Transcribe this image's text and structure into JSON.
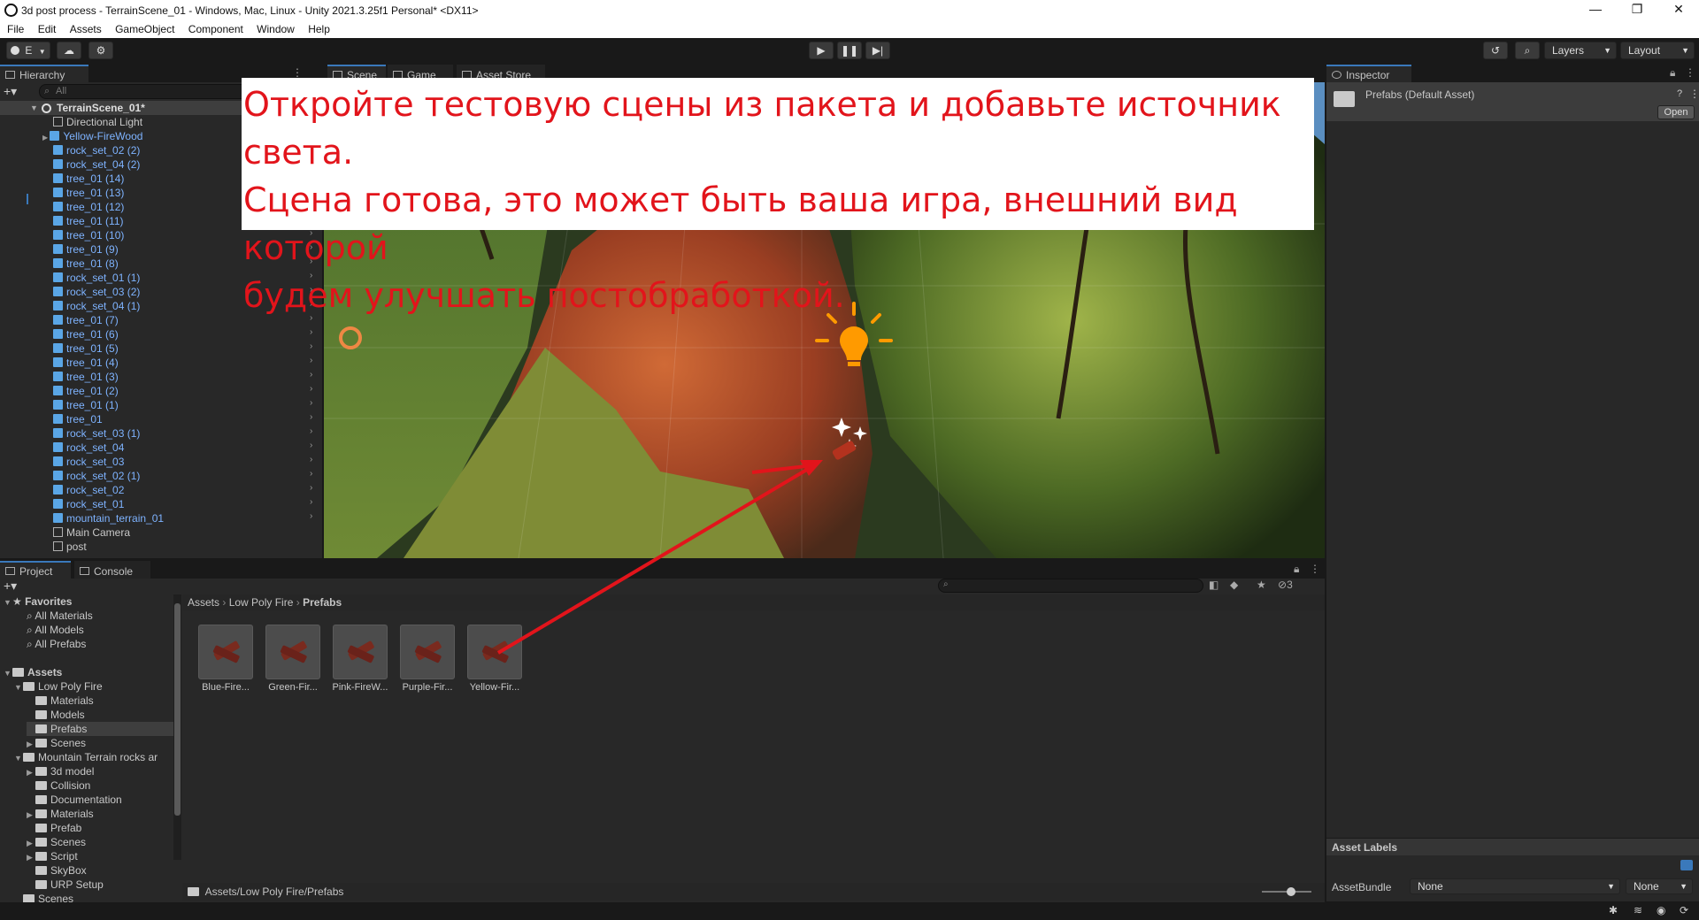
{
  "window": {
    "title": "3d post process - TerrainScene_01 - Windows, Mac, Linux - Unity 2021.3.25f1 Personal* <DX11>",
    "minimize": "—",
    "maximize": "❐",
    "close": "✕"
  },
  "menu": [
    "File",
    "Edit",
    "Assets",
    "GameObject",
    "Component",
    "Window",
    "Help"
  ],
  "toolbar": {
    "account_label": "E",
    "layers_label": "Layers",
    "layout_label": "Layout"
  },
  "hierarchy": {
    "tab_label": "Hierarchy",
    "search_placeholder": "All",
    "scene_name": "TerrainScene_01*",
    "items": [
      "Directional Light",
      "Yellow-FireWood",
      "rock_set_02 (2)",
      "rock_set_04 (2)",
      "tree_01 (14)",
      "tree_01 (13)",
      "tree_01 (12)",
      "tree_01 (11)",
      "tree_01 (10)",
      "tree_01 (9)",
      "tree_01 (8)",
      "rock_set_01 (1)",
      "rock_set_03 (2)",
      "rock_set_04 (1)",
      "tree_01 (7)",
      "tree_01 (6)",
      "tree_01 (5)",
      "tree_01 (4)",
      "tree_01 (3)",
      "tree_01 (2)",
      "tree_01 (1)",
      "tree_01",
      "rock_set_03 (1)",
      "rock_set_04",
      "rock_set_03",
      "rock_set_02 (1)",
      "rock_set_02",
      "rock_set_01",
      "mountain_terrain_01",
      "Main Camera",
      "post"
    ]
  },
  "scene_tabs": [
    "Scene",
    "Game",
    "Asset Store"
  ],
  "annotation": {
    "lines": [
      "Откройте тестовую сцены из пакета и добавьте источник света.",
      "Сцена готова, это может быть ваша игра, внешний вид которой",
      "будем улучшать постобработкой."
    ],
    "color": "#e2141b"
  },
  "inspector": {
    "tab_label": "Inspector",
    "asset_title": "Prefabs (Default Asset)",
    "open_button": "Open",
    "asset_labels_header": "Asset Labels",
    "assetbundle_label": "AssetBundle",
    "assetbundle_value": "None",
    "variant_value": "None"
  },
  "project": {
    "tabs": [
      "Project",
      "Console"
    ],
    "favorites_label": "Favorites",
    "favorites": [
      "All Materials",
      "All Models",
      "All Prefabs"
    ],
    "assets_label": "Assets",
    "tree": [
      {
        "label": "Low Poly Fire",
        "level": 1,
        "expanded": true
      },
      {
        "label": "Materials",
        "level": 2
      },
      {
        "label": "Models",
        "level": 2
      },
      {
        "label": "Prefabs",
        "level": 2,
        "selected": true
      },
      {
        "label": "Scenes",
        "level": 2,
        "collapsed": true
      },
      {
        "label": "Mountain Terrain rocks ar",
        "level": 1,
        "expanded": true
      },
      {
        "label": "3d model",
        "level": 2,
        "collapsed": true
      },
      {
        "label": "Collision",
        "level": 2
      },
      {
        "label": "Documentation",
        "level": 2
      },
      {
        "label": "Materials",
        "level": 2,
        "collapsed": true
      },
      {
        "label": "Prefab",
        "level": 2
      },
      {
        "label": "Scenes",
        "level": 2,
        "collapsed": true
      },
      {
        "label": "Script",
        "level": 2,
        "collapsed": true
      },
      {
        "label": "SkyBox",
        "level": 2
      },
      {
        "label": "URP Setup",
        "level": 2
      },
      {
        "label": "Scenes",
        "level": 1
      }
    ],
    "breadcrumb": [
      "Assets",
      "Low Poly Fire",
      "Prefabs"
    ],
    "assets": [
      "Blue-Fire...",
      "Green-Fir...",
      "Pink-FireW...",
      "Purple-Fir...",
      "Yellow-Fir..."
    ],
    "path": "Assets/Low Poly Fire/Prefabs",
    "hidden_count": "3"
  }
}
